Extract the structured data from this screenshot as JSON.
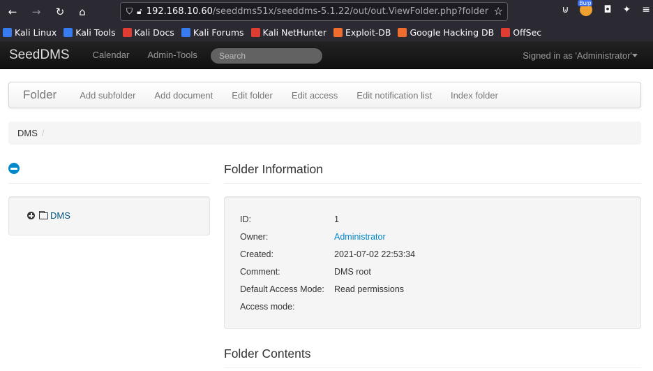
{
  "browser": {
    "url_host": "192.168.10.60",
    "url_path": "/seeddms51x/seeddms-5.1.22/out/out.ViewFolder.php?folder",
    "bookmarks": [
      {
        "label": "Kali Linux",
        "color": "#367bf0"
      },
      {
        "label": "Kali Tools",
        "color": "#367bf0"
      },
      {
        "label": "Kali Docs",
        "color": "#e03c31"
      },
      {
        "label": "Kali Forums",
        "color": "#367bf0"
      },
      {
        "label": "Kali NetHunter",
        "color": "#e03c31"
      },
      {
        "label": "Exploit-DB",
        "color": "#f06b2e"
      },
      {
        "label": "Google Hacking DB",
        "color": "#f06b2e"
      },
      {
        "label": "OffSec",
        "color": "#e03c31"
      }
    ],
    "burp_label": "Burp"
  },
  "nav": {
    "brand": "SeedDMS",
    "links": [
      "Calendar",
      "Admin-Tools"
    ],
    "search_placeholder": "Search",
    "signed_in": "Signed in as 'Administrator'"
  },
  "subnav": {
    "brand": "Folder",
    "links": [
      "Add subfolder",
      "Add document",
      "Edit folder",
      "Edit access",
      "Edit notification list",
      "Index folder"
    ]
  },
  "breadcrumb": {
    "root": "DMS",
    "separator": "/"
  },
  "tree": {
    "root_label": "DMS"
  },
  "folder_info": {
    "heading": "Folder Information",
    "rows": [
      {
        "label": "ID:",
        "value": "1"
      },
      {
        "label": "Owner:",
        "value": "Administrator"
      },
      {
        "label": "Created:",
        "value": "2021-07-02 22:53:34"
      },
      {
        "label": "Comment:",
        "value": "DMS root"
      },
      {
        "label": "Default Access Mode:",
        "value": "Read permissions"
      },
      {
        "label": "Access mode:",
        "value": ""
      }
    ]
  },
  "folder_contents": {
    "heading": "Folder Contents"
  },
  "colors": {
    "link": "#0088cc",
    "navbar": "#1b1b1b",
    "browser_chrome": "#2b2a33"
  }
}
